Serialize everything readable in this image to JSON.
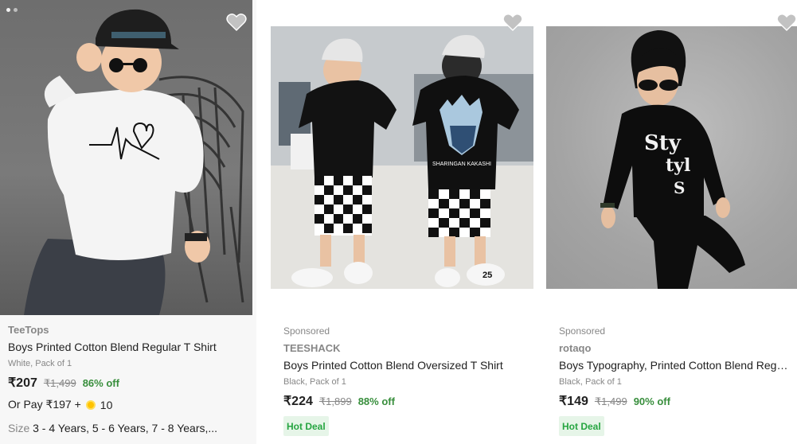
{
  "products": [
    {
      "sponsored": "",
      "brand": "TeeTops",
      "title": "Boys Printed Cotton Blend Regular T Shirt",
      "variant": "White, Pack of 1",
      "price": "₹207",
      "mrp": "₹1,499",
      "discount": "86% off",
      "or_pay_text": "Or Pay ₹197 +",
      "coins": "10",
      "size_label": "Size",
      "size_values": "3 - 4 Years, 5 - 6 Years, 7 - 8 Years,..."
    },
    {
      "sponsored": "Sponsored",
      "brand": "TEESHACK",
      "title": "Boys Printed Cotton Blend Oversized T Shirt",
      "variant": "Black, Pack of 1",
      "price": "₹224",
      "mrp": "₹1,899",
      "discount": "88% off",
      "badge": "Hot Deal"
    },
    {
      "sponsored": "Sponsored",
      "brand": "rotaqo",
      "title": "Boys Typography, Printed Cotton Blend Regul...",
      "variant": "Black, Pack of 1",
      "price": "₹149",
      "mrp": "₹1,499",
      "discount": "90% off",
      "badge": "Hot Deal"
    }
  ],
  "image_texts": {
    "kakashi_print": "SHARINGAN KAKASHI",
    "shoe_number": "25",
    "style_print": "Sty tyl S"
  },
  "icons": {
    "wishlist": "heart-icon",
    "coin": "supercoin-icon"
  },
  "colors": {
    "discount_green": "#388e3c",
    "hot_deal_bg": "#e6f5e8",
    "hot_deal_text": "#26a541",
    "wishlist_gray": "#c2c2c2",
    "coin_gold": "#ffc200"
  }
}
